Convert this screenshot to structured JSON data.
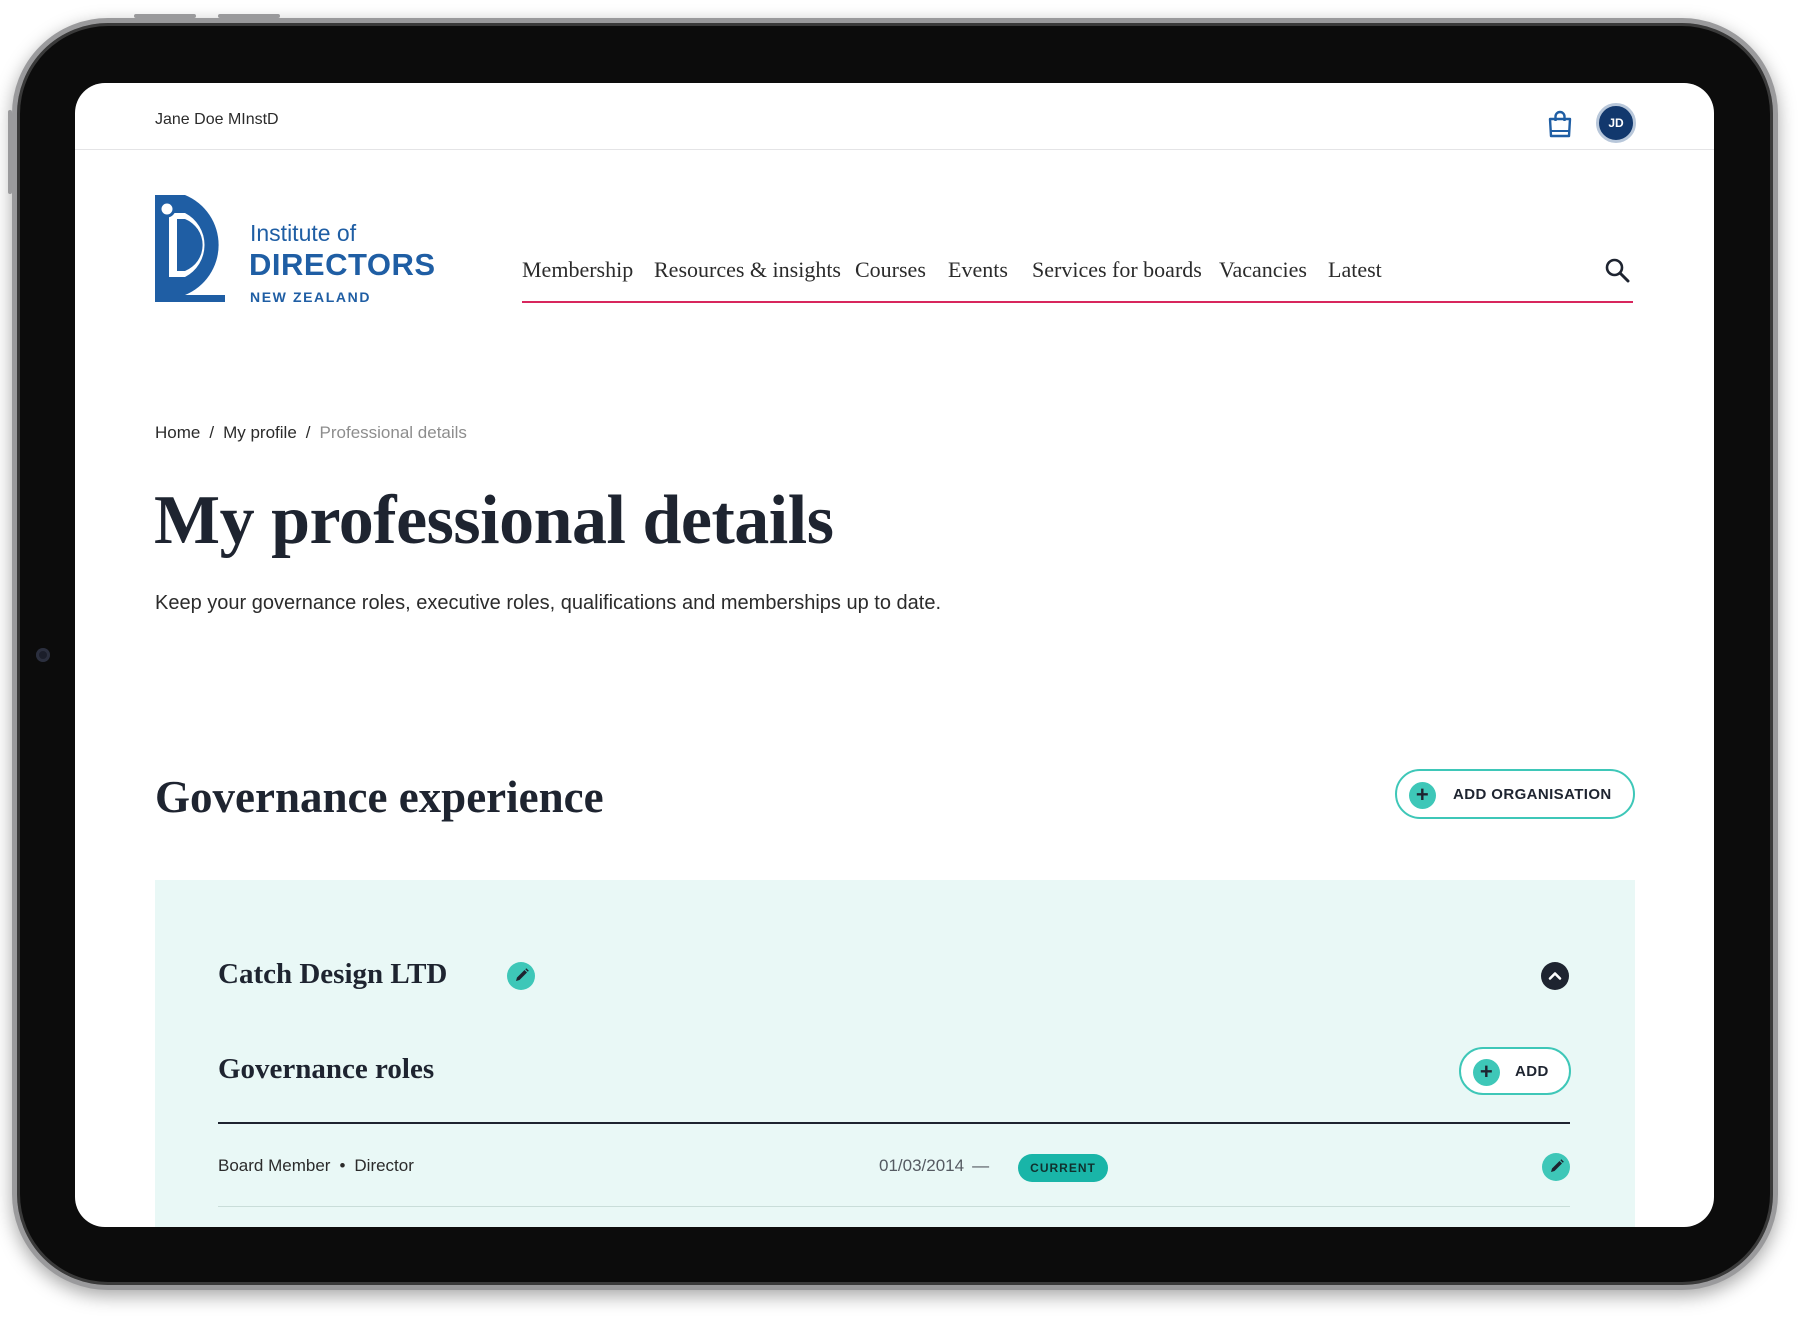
{
  "topbar": {
    "user_name": "Jane Doe MInstD",
    "avatar_initials": "JD"
  },
  "logo": {
    "line1": "Institute of",
    "line2": "DIRECTORS",
    "line3": "NEW ZEALAND"
  },
  "nav": {
    "items": [
      "Membership",
      "Resources & insights",
      "Courses",
      "Events",
      "Services for boards",
      "Vacancies",
      "Latest"
    ]
  },
  "breadcrumb": {
    "items": [
      "Home",
      "My profile",
      "Professional details"
    ],
    "separator": "/"
  },
  "page": {
    "title": "My professional details",
    "intro": "Keep your governance roles, executive roles, qualifications and memberships up to date."
  },
  "governance": {
    "title": "Governance experience",
    "add_label": "ADD ORGANISATION",
    "organisations": [
      {
        "name": "Catch Design LTD",
        "roles_title": "Governance roles",
        "add_role_label": "ADD",
        "roles": [
          {
            "position": "Board Member",
            "role": "Director",
            "start_date": "01/03/2014",
            "date_separator": "—",
            "status": "CURRENT"
          }
        ]
      }
    ]
  },
  "colors": {
    "brand_blue": "#1f5ea4",
    "nav_underline": "#d8265d",
    "accent_teal": "#3ec7b8",
    "card_bg": "#e9f8f6",
    "heading": "#1e2430"
  },
  "icons": [
    "shopping-bag-icon",
    "search-icon",
    "plus-icon",
    "pencil-icon",
    "chevron-up-icon"
  ]
}
